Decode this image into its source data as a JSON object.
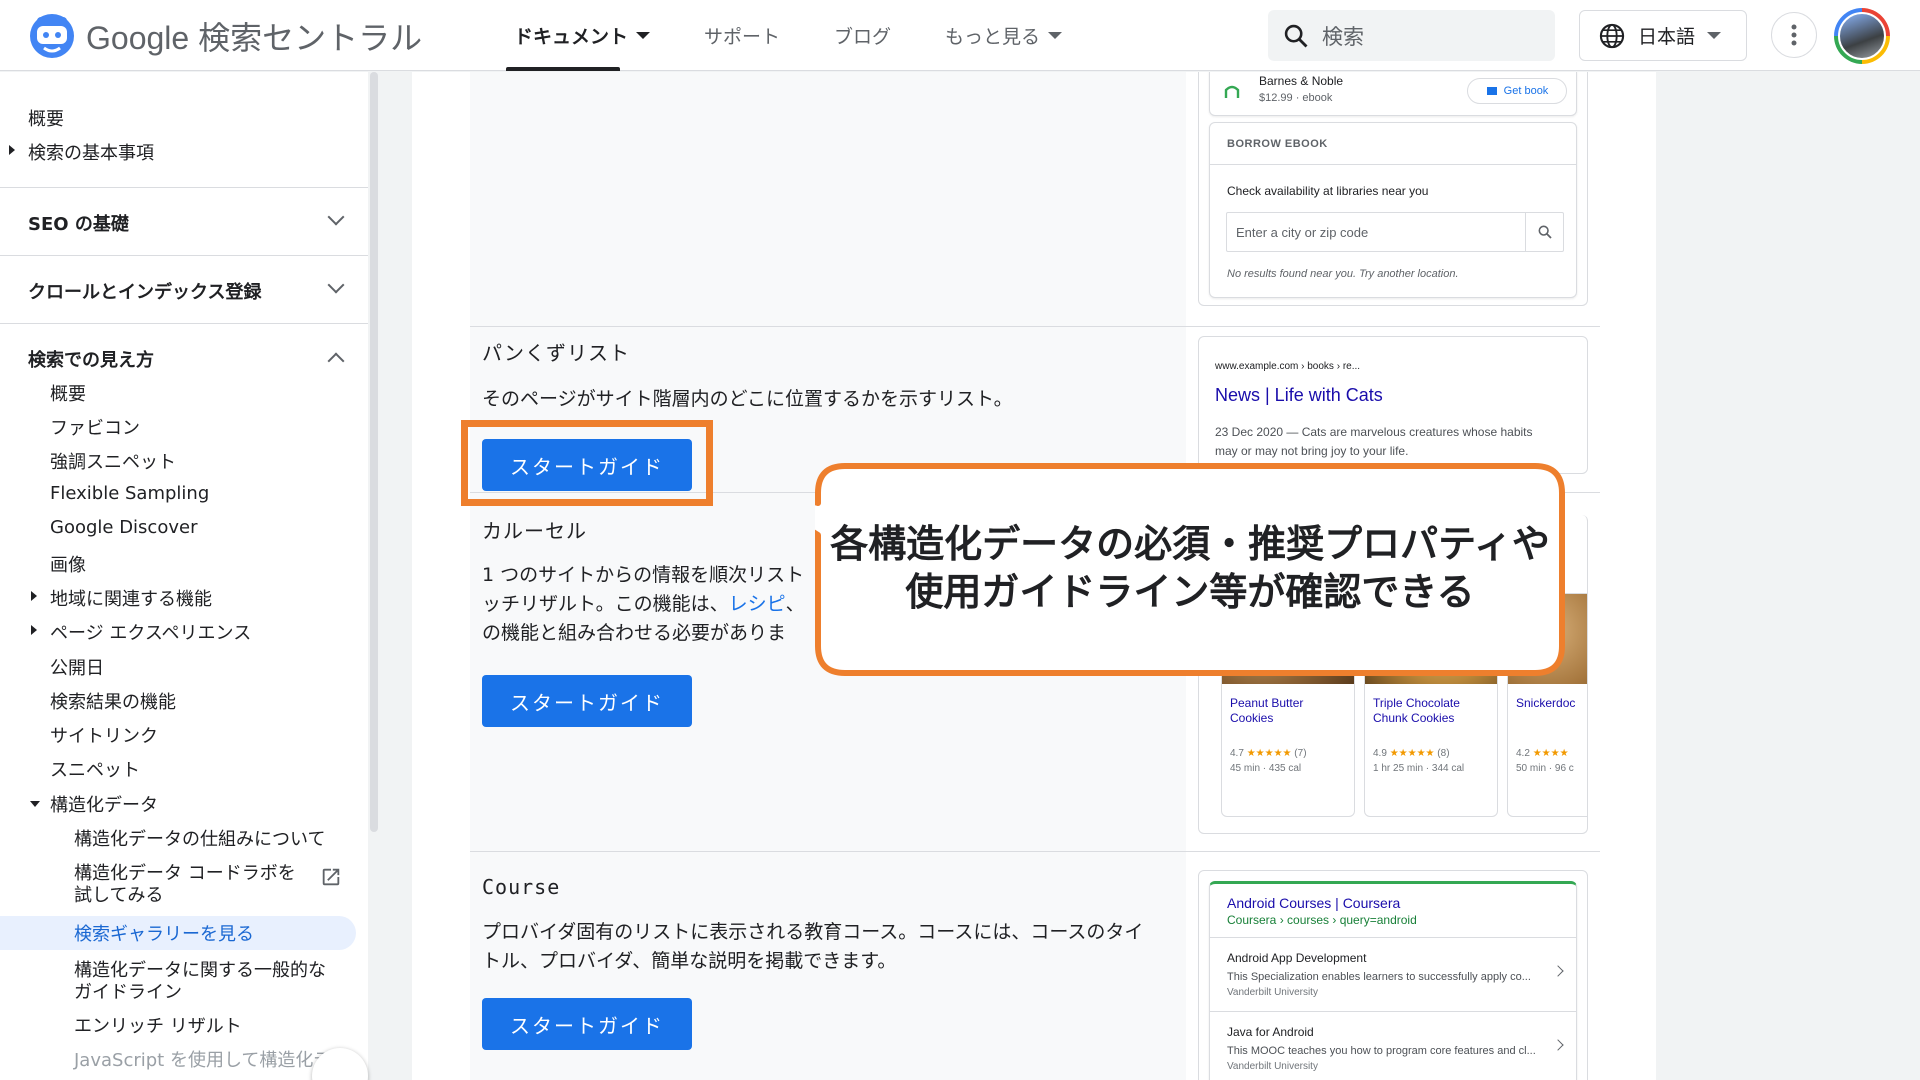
{
  "header": {
    "brand_google": "Google",
    "brand_product": "検索セントラル",
    "nav": [
      {
        "label": "ドキュメント",
        "dropdown": true,
        "active": true
      },
      {
        "label": "サポート",
        "dropdown": false,
        "active": false
      },
      {
        "label": "ブログ",
        "dropdown": false,
        "active": false
      },
      {
        "label": "もっと見る",
        "dropdown": true,
        "active": false
      }
    ],
    "search_placeholder": "検索",
    "language": "日本語",
    "icons": {
      "search": "search-icon",
      "globe": "globe-icon",
      "more": "more-vert-icon"
    }
  },
  "sidebar": {
    "top_items": [
      "概要",
      "検索の基本事項"
    ],
    "sections": [
      "SEO の基礎",
      "クロールとインデックス登録",
      "検索での見え方"
    ],
    "sub_items": [
      "概要",
      "ファビコン",
      "強調スニペット",
      "Flexible Sampling",
      "Google Discover",
      "画像",
      "地域に関連する機能",
      "ページ エクスペリエンス",
      "公開日",
      "検索結果の機能",
      "サイトリンク",
      "スニペット",
      "構造化データ"
    ],
    "structured_children": [
      "構造化データの仕組みについて",
      "構造化データ コードラボを",
      "試してみる",
      "検索ギャラリーを見る",
      "構造化データに関する一般的な",
      "ガイドライン",
      "エンリッチ リザルト",
      "JavaScript を使用して構造化デ"
    ],
    "selected": "検索ギャラリーを見る"
  },
  "main": {
    "button_label": "スタートガイド",
    "features": [
      {
        "title": "パンくずリスト",
        "desc": "そのページがサイト階層内のどこに位置するかを示すリスト。"
      },
      {
        "title": "カルーセル",
        "desc_1": "1 つのサイトからの情報を順次リスト",
        "desc_2": "ッチリザルト。この機能は、",
        "desc_2_link": "レシピ",
        "desc_2_end": "、",
        "desc_3": "の機能と組み合わせる必要がありま"
      },
      {
        "title": "Course",
        "desc": "プロバイダ固有のリストに表示される教育コース。コースには、コースのタイトル、プロバイダ、簡単な説明を掲載できます。"
      }
    ]
  },
  "previews": {
    "book": {
      "seller": "Barnes & Noble",
      "price": "$12.99 · ebook",
      "get_book": "Get book",
      "borrow_header": "BORROW EBOOK",
      "check": "Check availability at libraries near you",
      "zip_placeholder": "Enter a city or zip code",
      "no_results": "No results found near you. Try another location."
    },
    "breadcrumb": {
      "url": "www.example.com › books › re...",
      "title": "News | Life with Cats",
      "snippet_1": "23 Dec 2020 — Cats are marvelous creatures whose habits",
      "snippet_2": "may or may not bring joy to your life."
    },
    "carousel": [
      {
        "name_1": "Peanut Butter",
        "name_2": "Cookies",
        "rating": "4.7",
        "stars": "★★★★★",
        "count": "(7)",
        "meta": "45 min · 435 cal"
      },
      {
        "name_1": "Triple Chocolate",
        "name_2": "Chunk Cookies",
        "rating": "4.9",
        "stars": "★★★★★",
        "count": "(8)",
        "meta": "1 hr 25 min · 344 cal"
      },
      {
        "name_1": "Snickerdoc",
        "name_2": "",
        "rating": "4.2",
        "stars": "★★★★",
        "count": "",
        "meta": "50 min · 96 c"
      }
    ],
    "course": {
      "title": "Android Courses | Coursera",
      "crumb": "Coursera › courses › query=android",
      "items": [
        {
          "name": "Android App Development",
          "desc": "This Specialization enables learners to successfully apply co...",
          "provider": "Vanderbilt University"
        },
        {
          "name": "Java for Android",
          "desc": "This MOOC teaches you how to program core features and cl...",
          "provider": "Vanderbilt University"
        }
      ]
    }
  },
  "callout": {
    "line1": "各構造化データの必須・推奨プロパティや",
    "line2": "使用ガイドライン等が確認できる",
    "border_color": "#ee7f2d"
  },
  "colors": {
    "accent": "#1a73e8",
    "highlight": "#ee7f2d",
    "selected_bg": "#e8f0fe"
  }
}
